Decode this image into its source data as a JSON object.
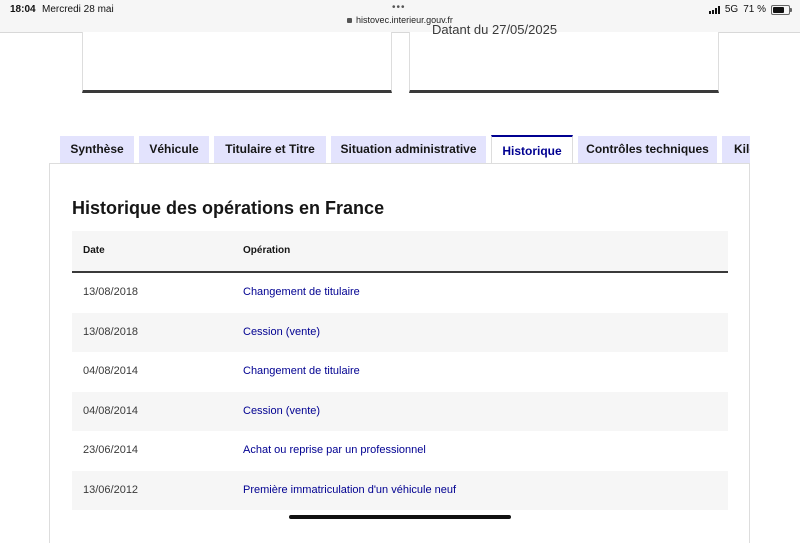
{
  "status_bar": {
    "time": "18:04",
    "date": "Mercredi 28 mai",
    "url": "histovec.interieur.gouv.fr",
    "network": "5G",
    "battery": "71 %",
    "battery_level": 0.71
  },
  "top_card": {
    "partial_text": "Datant du 27/05/2025"
  },
  "tabs": [
    {
      "label": "Synthèse"
    },
    {
      "label": "Véhicule"
    },
    {
      "label": "Titulaire et Titre"
    },
    {
      "label": "Situation administrative"
    },
    {
      "label": "Historique",
      "active": true
    },
    {
      "label": "Contrôles techniques"
    },
    {
      "label": "Kilométrage"
    }
  ],
  "section": {
    "title": "Historique des opérations en France"
  },
  "table": {
    "headers": {
      "date": "Date",
      "operation": "Opération"
    },
    "rows": [
      {
        "date": "13/08/2018",
        "operation": "Changement de titulaire"
      },
      {
        "date": "13/08/2018",
        "operation": "Cession (vente)"
      },
      {
        "date": "04/08/2014",
        "operation": "Changement de titulaire"
      },
      {
        "date": "04/08/2014",
        "operation": "Cession (vente)"
      },
      {
        "date": "23/06/2014",
        "operation": "Achat ou reprise par un professionnel"
      },
      {
        "date": "13/06/2012",
        "operation": "Première immatriculation d'un véhicule neuf"
      }
    ]
  },
  "colors": {
    "accent": "#000091",
    "tab_bg": "#e3e3fd",
    "row_alt": "#f6f6f6"
  }
}
